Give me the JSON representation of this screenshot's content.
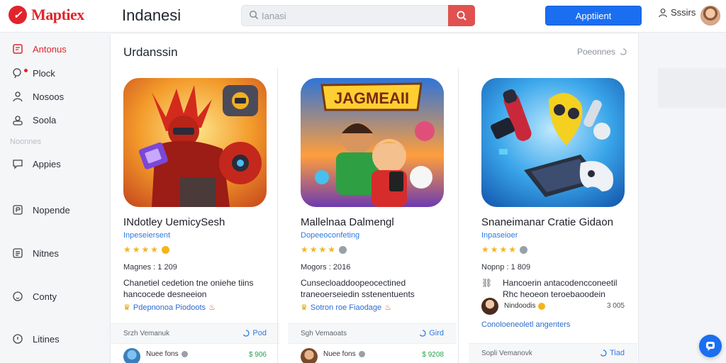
{
  "header": {
    "logo_text": "Maptiex",
    "title": "Indanesi",
    "search_placeholder": "Ianasi",
    "primary_button": "Apptiient",
    "user_label": "Sssirs"
  },
  "sidebar": {
    "items": [
      {
        "label": "Antonus",
        "icon": "tablet-icon",
        "active": true
      },
      {
        "label": "Plock",
        "icon": "location-icon"
      },
      {
        "label": "Nosoos",
        "icon": "user-icon"
      },
      {
        "label": "Soola",
        "icon": "user-outline-icon"
      },
      {
        "label": "Appies",
        "icon": "chat-icon"
      },
      {
        "label": "Nopende",
        "icon": "box-icon"
      },
      {
        "label": "Nitnes",
        "icon": "doc-icon"
      },
      {
        "label": "Conty",
        "icon": "clock-icon"
      },
      {
        "label": "Litines",
        "icon": "circle-icon"
      }
    ],
    "section_label": "Noonnes"
  },
  "main": {
    "section_title": "Urdanssin",
    "see_more": "Poeonnes",
    "cards": [
      {
        "title": "INdotley UemicySesh",
        "subtitle": "Inpeseiersent",
        "rating_dot_color": "#f3b51a",
        "meta": "Magnes : 1 209",
        "description": "Chanetiel cedetion tne oniehe tiins hancocede desneeion",
        "tag": "Pdepnonoa Piodoots",
        "foot_left": "Srzh Vemanuk",
        "foot_right": "Pod",
        "dev_name": "Nuee fons",
        "price": "$ 906"
      },
      {
        "title": "Mallelnaa Dalmengl",
        "subtitle": "Dopeeoconfeting",
        "rating_dot_color": "#9aa0a8",
        "meta": "Mogors : 2016",
        "description": "Cunsecloaddoopeocectined traneoerseiedin sstenentuents",
        "tag": "Sotron roe Fiaodage",
        "foot_left": "Sgh Vemaoats",
        "foot_right": "Gird",
        "dev_name": "Nuee fons",
        "price": "$ 9208"
      },
      {
        "title": "Snaneimanar Cratie Gidaon",
        "subtitle": "Inpaseioer",
        "rating_dot_color": "#9aa0a8",
        "meta": "Nopnp : 1 809",
        "description": "Hancoerin antacodencconeetil Rhc heoeon teroebaoodein",
        "dev_line_name": "Nindoodis",
        "dev_line_count": "3 005",
        "tag": "Conoloeneoletl angenters",
        "foot_left": "Sopli Vemanovk",
        "foot_right": "Tiad"
      }
    ]
  }
}
